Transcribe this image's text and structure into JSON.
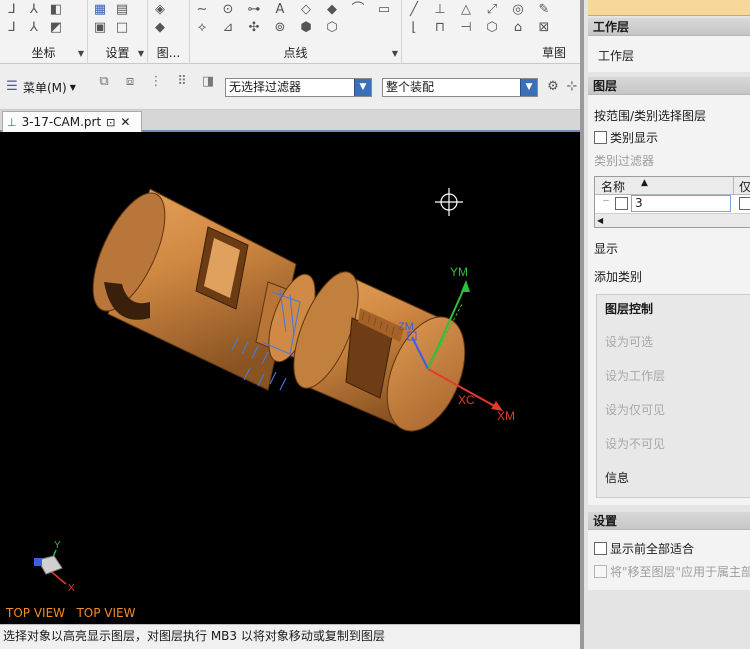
{
  "ribbon": {
    "groups": [
      {
        "label": "坐标"
      },
      {
        "label": "设置"
      },
      {
        "label": "图..."
      },
      {
        "label": "点线"
      },
      {
        "label": "草图"
      }
    ]
  },
  "toolbar": {
    "menu_label": "菜单(M)",
    "selection_filter": "无选择过滤器",
    "assembly_scope": "整个装配"
  },
  "file_tab": {
    "label": "3-17-CAM.prt"
  },
  "viewport": {
    "background": "#000000",
    "part_color": "#c9843f",
    "axis_labels": {
      "ym": "YM",
      "xm": "XM",
      "xc": "XC",
      "zm": "ZM",
      "triad_y": "Y",
      "triad_x": "X"
    },
    "view_label": "TOP VIEW   TOP VIEW"
  },
  "status_bar": {
    "text": "选择对象以高亮显示图层，对图层执行 MB3 以将对象移动或复制到图层"
  },
  "panel": {
    "work_layer": {
      "header": "工作层",
      "label": "工作层"
    },
    "layer": {
      "header": "图层",
      "select_by_range": "按范围/类别选择图层",
      "category_display": "类别显示",
      "category_filter": "类别过滤器",
      "table": {
        "col_name": "名称",
        "col_only": "仅",
        "rows": [
          {
            "name": "3"
          }
        ]
      },
      "display": "显示",
      "add_category": "添加类别"
    },
    "layer_control": {
      "header": "图层控制",
      "set_selectable": "设为可选",
      "set_work_layer": "设为工作层",
      "set_visible_only": "设为仅可见",
      "set_invisible": "设为不可见",
      "info": "信息"
    },
    "settings": {
      "header": "设置",
      "fit_before_display": "显示前全部适合",
      "apply_move_to_layer": "将\"移至图层\"应用于属主部"
    }
  }
}
